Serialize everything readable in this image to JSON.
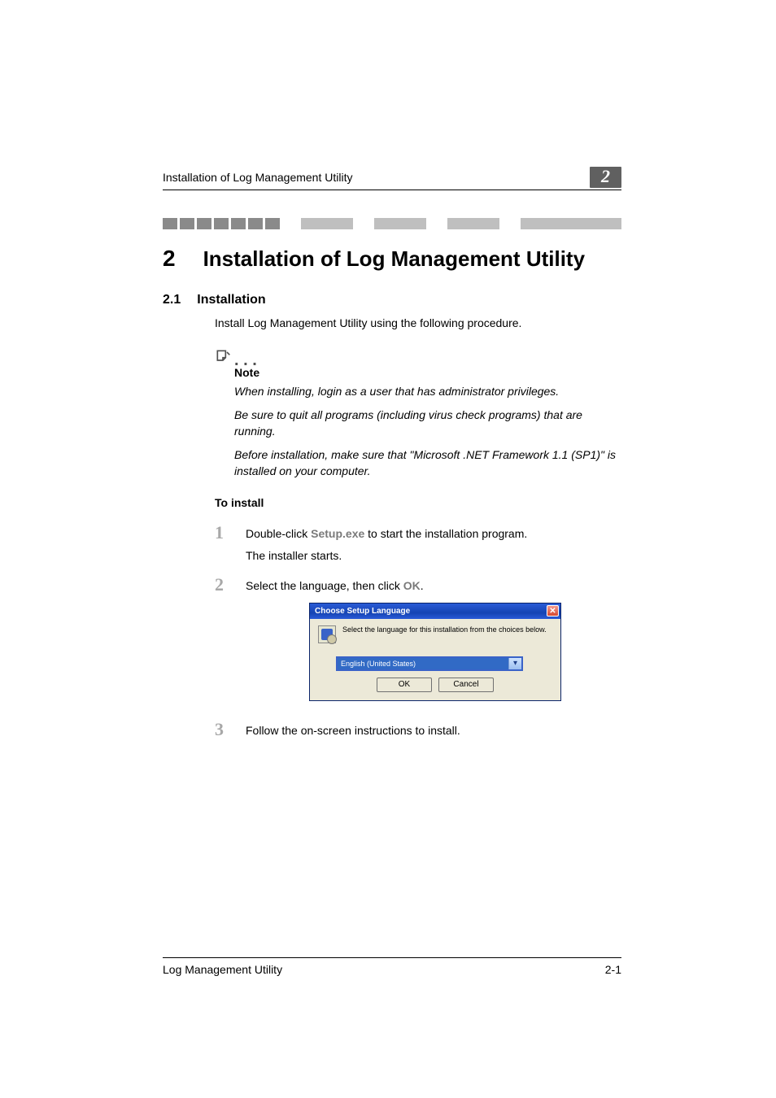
{
  "header": {
    "running_title": "Installation of Log Management Utility",
    "chapter_badge": "2"
  },
  "h1": {
    "number": "2",
    "text": "Installation of Log Management Utility"
  },
  "h2": {
    "number": "2.1",
    "text": "Installation"
  },
  "intro": "Install Log Management Utility using the following procedure.",
  "note": {
    "heading": "Note",
    "items": [
      "When installing, login as a user that has administrator privileges.",
      "Be sure to quit all programs (including virus check programs) that are running.",
      "Before installation, make sure that \"Microsoft .NET Framework 1.1 (SP1)\" is installed on your computer."
    ]
  },
  "to_install": "To install",
  "steps": {
    "s1": {
      "num": "1",
      "pre": "Double-click ",
      "bold": "Setup.exe",
      "post": " to start the installation program.",
      "sub": "The installer starts."
    },
    "s2": {
      "num": "2",
      "pre": "Select the language, then click ",
      "bold": "OK",
      "post": "."
    },
    "s3": {
      "num": "3",
      "text": "Follow the on-screen instructions to install."
    }
  },
  "dialog": {
    "title": "Choose Setup Language",
    "message": "Select the language for this installation from the choices below.",
    "selected": "English (United States)",
    "ok": "OK",
    "cancel": "Cancel"
  },
  "footer": {
    "left": "Log Management Utility",
    "right": "2-1"
  }
}
